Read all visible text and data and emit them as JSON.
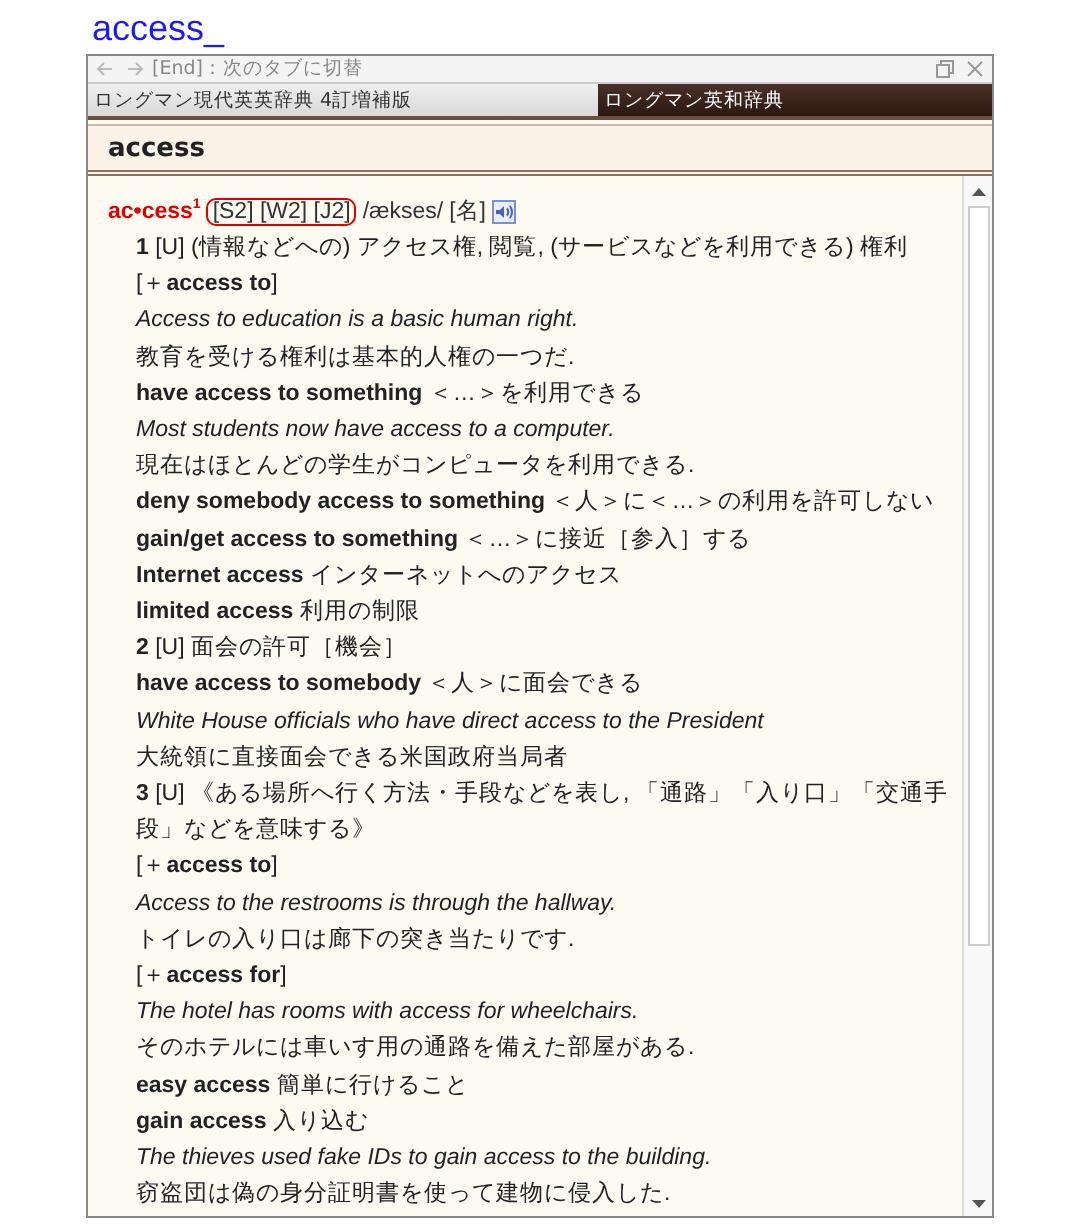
{
  "search": {
    "value": "access_"
  },
  "toolbar": {
    "hint": "[End]：次のタブに切替"
  },
  "tabs": [
    {
      "label": "ロングマン現代英英辞典 4訂増補版",
      "selected": false
    },
    {
      "label": "ロングマン英和辞典",
      "selected": true
    }
  ],
  "entry_title": "access",
  "headword": {
    "word": "ac•cess",
    "index": "1",
    "labels": "[S2] [W2] [J2]",
    "pronunciation": "/ækses/",
    "pos": "[名]"
  },
  "lines": [
    {
      "kind": "sense",
      "text": "**1** [U] (情報などへの) アクセス権, 閲覧, (サービスなどを利用できる) 権利"
    },
    {
      "kind": "pattern",
      "text": "[＋**access to**]"
    },
    {
      "kind": "example",
      "text": "Access to education is a basic human right."
    },
    {
      "kind": "translation",
      "text": "教育を受ける権利は基本的人権の一つだ."
    },
    {
      "kind": "phrase",
      "text": "**have access to something** ＜…＞を利用できる"
    },
    {
      "kind": "example",
      "text": "Most students now have access to a computer."
    },
    {
      "kind": "translation",
      "text": "現在はほとんどの学生がコンピュータを利用できる."
    },
    {
      "kind": "phrase",
      "text": "**deny somebody access to something** ＜人＞に＜…＞の利用を許可しない"
    },
    {
      "kind": "phrase",
      "text": "**gain/get access to something** ＜…＞に接近［参入］する"
    },
    {
      "kind": "phrase",
      "text": "**Internet access** インターネットへのアクセス"
    },
    {
      "kind": "phrase",
      "text": "**limited access** 利用の制限"
    },
    {
      "kind": "sense",
      "text": "**2** [U] 面会の許可［機会］"
    },
    {
      "kind": "phrase",
      "text": "**have access to somebody** ＜人＞に面会できる"
    },
    {
      "kind": "example",
      "text": "White House officials who have direct access to the President"
    },
    {
      "kind": "translation",
      "text": "大統領に直接面会できる米国政府当局者"
    },
    {
      "kind": "sense",
      "text": "**3** [U] 《ある場所へ行く方法・手段などを表し, 「通路」「入り口」「交通手段」などを意味する》"
    },
    {
      "kind": "pattern",
      "text": "[＋**access to**]"
    },
    {
      "kind": "example",
      "text": "Access to the restrooms is through the hallway."
    },
    {
      "kind": "translation",
      "text": "トイレの入り口は廊下の突き当たりです."
    },
    {
      "kind": "pattern",
      "text": "[＋**access for**]"
    },
    {
      "kind": "example",
      "text": "The hotel has rooms with access for wheelchairs."
    },
    {
      "kind": "translation",
      "text": "そのホテルには車いす用の通路を備えた部屋がある."
    },
    {
      "kind": "phrase",
      "text": "**easy access** 簡単に行けること"
    },
    {
      "kind": "phrase",
      "text": "**gain access** 入り込む"
    },
    {
      "kind": "example",
      "text": "The thieves used fake IDs to gain access to the building."
    },
    {
      "kind": "translation",
      "text": "窃盗団は偽の身分証明書を使って建物に侵入した."
    }
  ]
}
